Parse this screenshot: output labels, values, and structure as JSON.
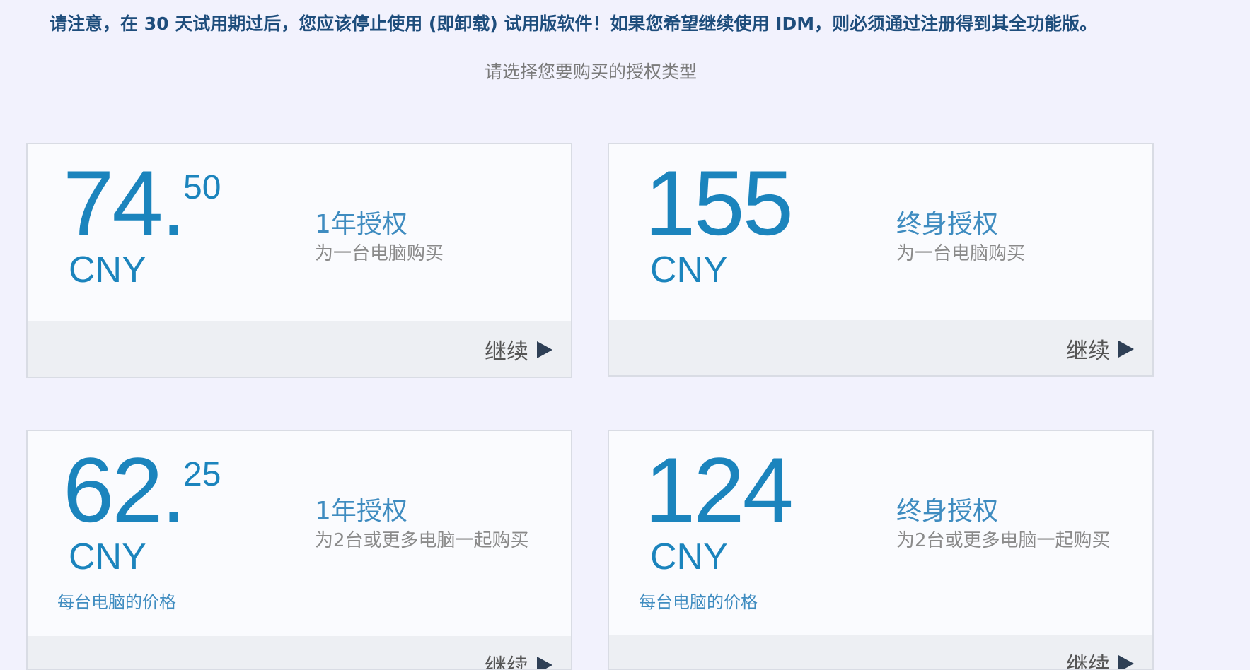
{
  "notice": "请注意，在 30 天试用期过后，您应该停止使用 (即卸载) 试用版软件！如果您希望继续使用 IDM，则必须通过注册得到其全功能版。",
  "subtitle": "请选择您要购买的授权类型",
  "cards": [
    {
      "price_int": "74.",
      "price_dec": "50",
      "currency": "CNY",
      "per_pc": "",
      "title": "1年授权",
      "desc": "为一台电脑购买",
      "continue_label": "继续"
    },
    {
      "price_int": "155",
      "price_dec": "",
      "currency": "CNY",
      "per_pc": "",
      "title": "终身授权",
      "desc": "为一台电脑购买",
      "continue_label": "继续"
    },
    {
      "price_int": "62.",
      "price_dec": "25",
      "currency": "CNY",
      "per_pc": "每台电脑的价格",
      "title": "1年授权",
      "desc": "为2台或更多电脑一起购买",
      "continue_label": "继续"
    },
    {
      "price_int": "124",
      "price_dec": "",
      "currency": "CNY",
      "per_pc": "每台电脑的价格",
      "title": "终身授权",
      "desc": "为2台或更多电脑一起购买",
      "continue_label": "继续"
    }
  ],
  "colors": {
    "accent": "#1b84bd",
    "notice": "#1e4d7c",
    "background": "#f2f2fd"
  }
}
